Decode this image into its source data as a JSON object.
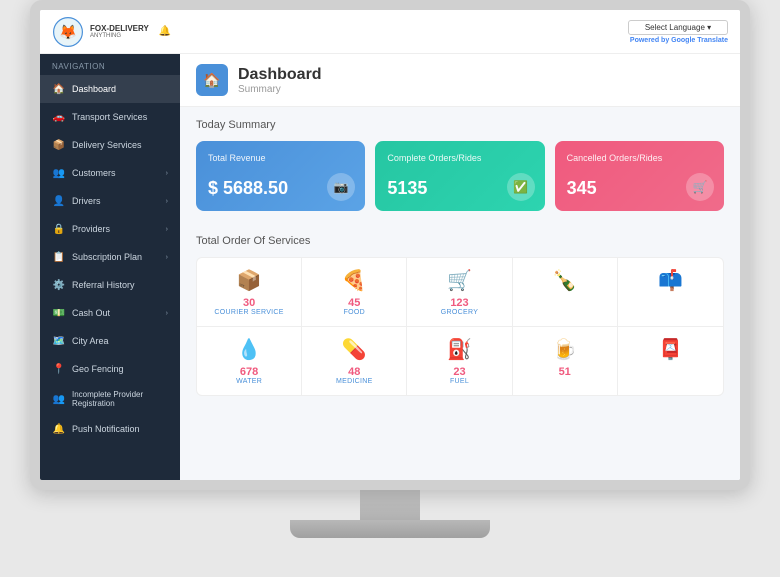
{
  "monitor": {
    "title": "Fox Delivery Anything Dashboard"
  },
  "topbar": {
    "logo_name": "FOX-DELIVERY",
    "logo_tagline": "ANYTHING",
    "translate_label": "Select Language",
    "powered_by": "Powered by",
    "google_label": "Google",
    "translate_label2": "Translate",
    "notification_icon": "🔔"
  },
  "sidebar": {
    "nav_label": "Navigation",
    "items": [
      {
        "label": "Dashboard",
        "icon": "🏠",
        "active": true,
        "has_arrow": false
      },
      {
        "label": "Transport Services",
        "icon": "🚗",
        "active": false,
        "has_arrow": false
      },
      {
        "label": "Delivery Services",
        "icon": "📦",
        "active": false,
        "has_arrow": false
      },
      {
        "label": "Customers",
        "icon": "👥",
        "active": false,
        "has_arrow": true
      },
      {
        "label": "Drivers",
        "icon": "👤",
        "active": false,
        "has_arrow": true
      },
      {
        "label": "Providers",
        "icon": "🔒",
        "active": false,
        "has_arrow": true
      },
      {
        "label": "Subscription Plan",
        "icon": "📋",
        "active": false,
        "has_arrow": true
      },
      {
        "label": "Referral History",
        "icon": "⚙️",
        "active": false,
        "has_arrow": false
      },
      {
        "label": "Cash Out",
        "icon": "💵",
        "active": false,
        "has_arrow": true
      },
      {
        "label": "City Area",
        "icon": "🗺️",
        "active": false,
        "has_arrow": false
      },
      {
        "label": "Geo Fencing",
        "icon": "📍",
        "active": false,
        "has_arrow": false
      },
      {
        "label": "Incomplete Provider Registration",
        "icon": "👥",
        "active": false,
        "has_arrow": false
      },
      {
        "label": "Push Notification",
        "icon": "🔔",
        "active": false,
        "has_arrow": false
      }
    ]
  },
  "dashboard": {
    "title": "Dashboard",
    "subtitle": "Summary",
    "icon": "🏠"
  },
  "today_summary": {
    "section_title": "Today Summary",
    "stats": [
      {
        "label": "Total Revenue",
        "value": "$ 5688.50",
        "color": "blue",
        "icon": "📷"
      },
      {
        "label": "Complete Orders/Rides",
        "value": "5135",
        "color": "green",
        "icon": "✅"
      },
      {
        "label": "Cancelled Orders/Rides",
        "value": "345",
        "color": "red",
        "icon": "🛒"
      }
    ]
  },
  "order_services": {
    "section_title": "Total Order Of Services",
    "services": [
      {
        "name": "COURIER SERVICE",
        "count": "30",
        "emoji": "📦"
      },
      {
        "name": "FOOD",
        "count": "45",
        "emoji": "🍕"
      },
      {
        "name": "GROCERY",
        "count": "123",
        "emoji": "🛒"
      },
      {
        "name": "",
        "count": "",
        "emoji": "🍾"
      },
      {
        "name": "WATER",
        "count": "678",
        "emoji": "💧"
      },
      {
        "name": "MEDICINE",
        "count": "48",
        "emoji": "🏥"
      },
      {
        "name": "FUEL",
        "count": "23",
        "emoji": "⛽"
      },
      {
        "name": "",
        "count": "51",
        "emoji": "🍺"
      }
    ]
  }
}
